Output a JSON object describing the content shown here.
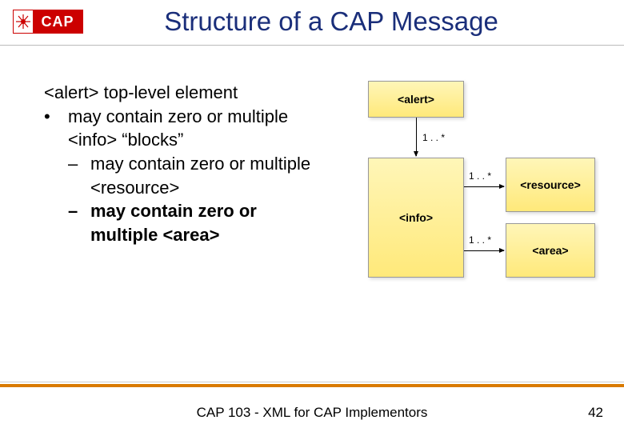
{
  "logo": {
    "text": "CAP"
  },
  "title": "Structure of a CAP Message",
  "body": {
    "line1": "<alert> top-level element",
    "bullet1": "may contain zero or multiple <info> “blocks”",
    "sub1": "may contain zero or multiple <resource>",
    "sub2": "may contain zero or multiple <area>"
  },
  "diagram": {
    "alert": "<alert>",
    "info": "<info>",
    "resource": "<resource>",
    "area": "<area>",
    "mult": "1 . . *"
  },
  "footer": {
    "text": "CAP 103 - XML for CAP Implementors",
    "page": "42"
  }
}
